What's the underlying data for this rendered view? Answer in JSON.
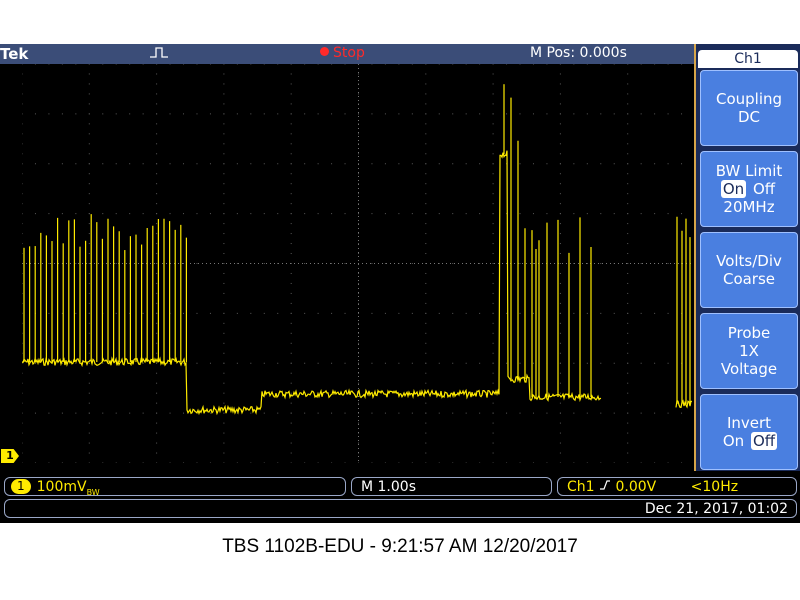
{
  "status_bar": {
    "brand": "Tek",
    "run_state": "Stop",
    "horizontal_position": "M Pos: 0.000s"
  },
  "side_menu": {
    "title": "Ch1",
    "buttons": [
      {
        "line1": "Coupling",
        "line2": "DC"
      },
      {
        "line1": "BW Limit",
        "opt_on": "On",
        "opt_off": "Off",
        "line3": "20MHz"
      },
      {
        "line1": "Volts/Div",
        "line2": "Coarse"
      },
      {
        "line1": "Probe",
        "line2": "1X",
        "line3": "Voltage"
      },
      {
        "line1": "Invert",
        "opt_on": "On",
        "opt_off": "Off"
      }
    ]
  },
  "readouts": {
    "channel_number": "1",
    "volts_per_div": "100mV",
    "bw_suffix": "BW",
    "timebase": "M 1.00s",
    "trigger_source": "Ch1",
    "trigger_slope_icon": "rising-edge-icon",
    "trigger_level": "0.00V",
    "trigger_frequency": "<10Hz",
    "datetime": "Dec 21, 2017, 01:02"
  },
  "ground_marker": "1",
  "caption": "TBS 1102B-EDU - 9:21:57 AM    12/20/2017",
  "colors": {
    "trace": "#ffeb00",
    "status_bar": "#3b4d78",
    "menu_button": "#4a7fe0",
    "stop": "#ff2a2a",
    "grid": "#5a5a5a"
  }
}
